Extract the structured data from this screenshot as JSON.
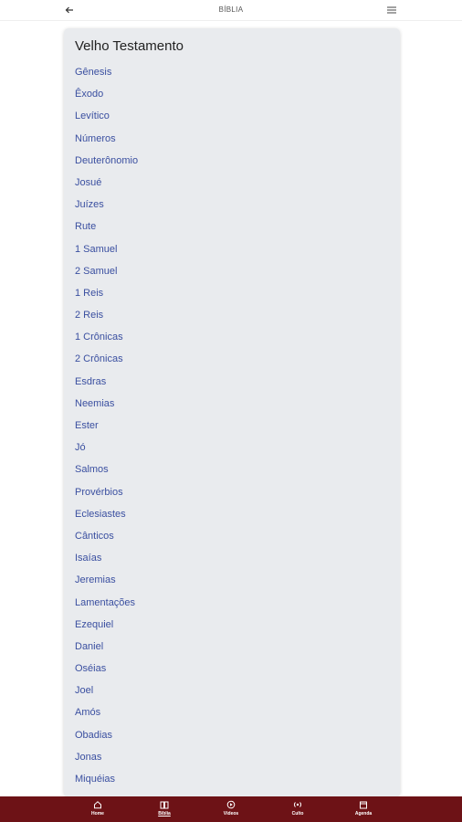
{
  "header": {
    "title": "BÍBLIA",
    "back_icon": "arrow-left-icon",
    "menu_icon": "hamburger-menu-icon"
  },
  "section": {
    "title": "Velho Testamento",
    "books": [
      "Gênesis",
      "Êxodo",
      "Levítico",
      "Números",
      "Deuterônomio",
      "Josué",
      "Juízes",
      "Rute",
      "1 Samuel",
      "2 Samuel",
      "1 Reis",
      "2 Reis",
      "1 Crônicas",
      "2 Crônicas",
      "Esdras",
      "Neemias",
      "Ester",
      "Jó",
      "Salmos",
      "Provérbios",
      "Eclesiastes",
      "Cânticos",
      "Isaías",
      "Jeremias",
      "Lamentações",
      "Ezequiel",
      "Daniel",
      "Oséias",
      "Joel",
      "Amós",
      "Obadias",
      "Jonas",
      "Miquéias"
    ]
  },
  "bottom_nav": {
    "items": [
      {
        "label": "Home",
        "icon": "home-icon"
      },
      {
        "label": "Bíblia",
        "icon": "book-icon",
        "active": true
      },
      {
        "label": "Vídeos",
        "icon": "video-icon"
      },
      {
        "label": "Culto",
        "icon": "broadcast-icon"
      },
      {
        "label": "Agenda",
        "icon": "calendar-icon"
      }
    ]
  },
  "colors": {
    "nav_bg": "#6d1216",
    "link": "#3a4fa0",
    "card_bg": "#e9ebee"
  }
}
